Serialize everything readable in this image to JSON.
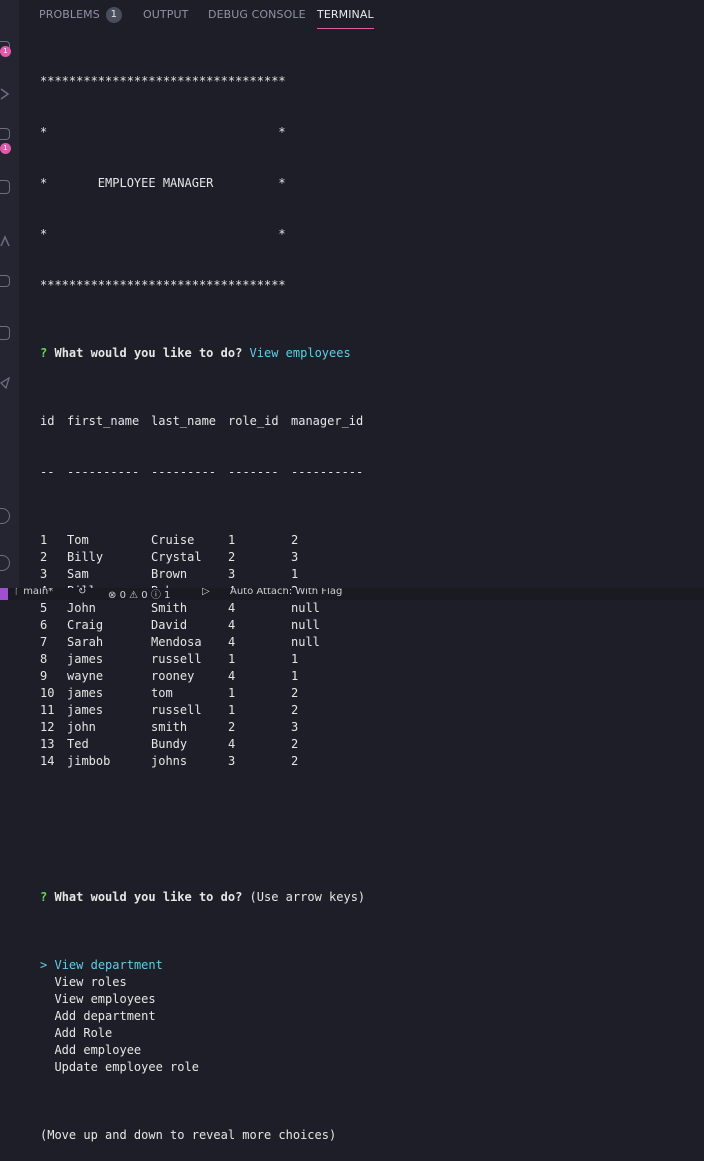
{
  "activity_bar": {
    "items": [
      {
        "icon": "explorer-icon",
        "badge": "1"
      },
      {
        "icon": "search-icon"
      },
      {
        "icon": "run-debug-icon",
        "badge": "1"
      },
      {
        "icon": "source-control-icon"
      },
      {
        "icon": "extensions-icon"
      },
      {
        "icon": "remote-icon"
      },
      {
        "icon": "testing-icon"
      },
      {
        "icon": "accounts-icon"
      },
      {
        "icon": "settings-gear-icon"
      }
    ]
  },
  "panel_tabs": {
    "problems": "PROBLEMS",
    "problems_count": "1",
    "output": "OUTPUT",
    "debug_console": "DEBUG CONSOLE",
    "terminal": "TERMINAL"
  },
  "terminal": {
    "banner": [
      "**********************************",
      "*                                *",
      "*       EMPLOYEE MANAGER         *",
      "*                                *",
      "**********************************"
    ],
    "question_mark": "?",
    "prompt": "What would you like to do?",
    "answer": "View employees",
    "table": {
      "headers": [
        "id",
        "first_name",
        "last_name",
        "role_id",
        "manager_id"
      ],
      "separators": [
        "--",
        "----------",
        "---------",
        "-------",
        "----------"
      ],
      "rows": [
        [
          "1",
          "Tom",
          "Cruise",
          "1",
          "2"
        ],
        [
          "2",
          "Billy",
          "Crystal",
          "2",
          "3"
        ],
        [
          "3",
          "Sam",
          "Brown",
          "3",
          "1"
        ],
        [
          "4",
          "Billy",
          "Bob",
          "4",
          "2"
        ],
        [
          "5",
          "John",
          "Smith",
          "4",
          "null"
        ],
        [
          "6",
          "Craig",
          "David",
          "4",
          "null"
        ],
        [
          "7",
          "Sarah",
          "Mendosa",
          "4",
          "null"
        ],
        [
          "8",
          "james",
          "russell",
          "1",
          "1"
        ],
        [
          "9",
          "wayne",
          "rooney",
          "4",
          "1"
        ],
        [
          "10",
          "james",
          "tom",
          "1",
          "2"
        ],
        [
          "11",
          "james",
          "russell",
          "1",
          "2"
        ],
        [
          "12",
          "john",
          "smith",
          "2",
          "3"
        ],
        [
          "13",
          "Ted",
          "Bundy",
          "4",
          "2"
        ],
        [
          "14",
          "jimbob",
          "johns",
          "3",
          "2"
        ]
      ]
    },
    "prompt2_hint": "(Use arrow keys)",
    "cursor": ">",
    "choices": [
      "View department",
      "View roles",
      "View employees",
      "Add department",
      "Add Role",
      "Add employee",
      "Update employee role"
    ],
    "more_hint": "(Move up and down to reveal more choices)"
  },
  "status_bar": {
    "branch": "main*",
    "errors": "0",
    "warnings": "0",
    "info": "1",
    "auto_attach": "Auto Attach: With Flag"
  },
  "colors": {
    "background": "#1e1e28",
    "question_mark": "#6fd35b",
    "highlight": "#5ccfe6",
    "tab_underline": "#e05aa9",
    "badge": "#e05aa9"
  }
}
